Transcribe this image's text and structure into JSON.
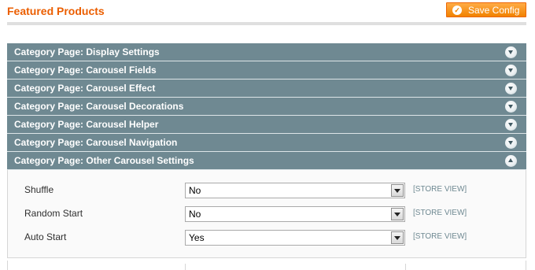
{
  "header": {
    "title": "Featured Products",
    "save_label": "Save Config",
    "save_icon": "check-circle-icon"
  },
  "sections": [
    {
      "label": "Category Page: Display Settings",
      "state": "collapsed"
    },
    {
      "label": "Category Page: Carousel Fields",
      "state": "collapsed"
    },
    {
      "label": "Category Page: Carousel Effect",
      "state": "collapsed"
    },
    {
      "label": "Category Page: Carousel Decorations",
      "state": "collapsed"
    },
    {
      "label": "Category Page: Carousel Helper",
      "state": "collapsed"
    },
    {
      "label": "Category Page: Carousel Navigation",
      "state": "collapsed"
    },
    {
      "label": "Category Page: Other Carousel Settings",
      "state": "expanded"
    }
  ],
  "fields": [
    {
      "label": "Shuffle",
      "value": "No",
      "scope": "[STORE VIEW]"
    },
    {
      "label": "Random Start",
      "value": "No",
      "scope": "[STORE VIEW]"
    },
    {
      "label": "Auto Start",
      "value": "Yes",
      "scope": "[STORE VIEW]"
    }
  ],
  "colors": {
    "accent": "#eb5e00",
    "button": "#f18200",
    "section_header": "#6f8992"
  }
}
